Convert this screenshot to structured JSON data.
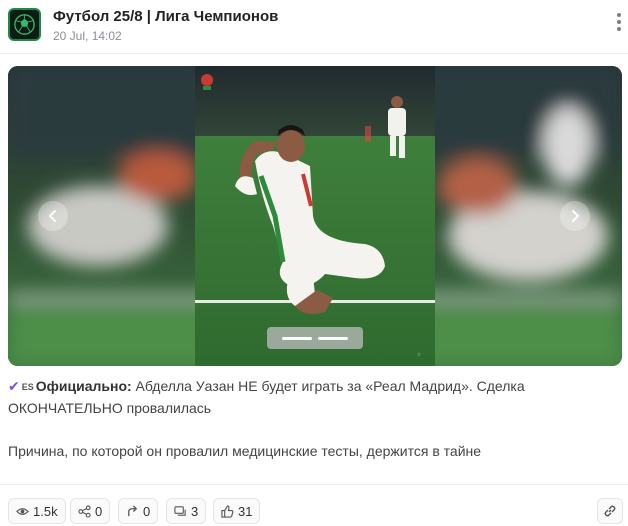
{
  "header": {
    "channel_title": "Футбол 25/8 | Лига Чемпионов",
    "post_time": "20 Jul, 14:02",
    "avatar_icon": "soccer-ball-logo",
    "more_icon": "vertical-dots-icon"
  },
  "gallery": {
    "prev_icon": "chevron-left-icon",
    "next_icon": "chevron-right-icon",
    "slide_count": 2,
    "active_slide": 1,
    "accent_color": "#1d8a4a"
  },
  "post": {
    "verified_icon": "✔",
    "flag_label": "ES",
    "lead_bold": "Официально:",
    "lead_text": " Абделла Уазан НЕ будет играть за «Реал Мадрид». Сделка ОКОНЧАТЕЛЬНО провалилась",
    "paragraph2": "Причина, по которой он провалил медицинские тесты, держится в тайне"
  },
  "footer": {
    "views": "1.5k",
    "forwards": "0",
    "shares": "0",
    "comments": "3",
    "likes": "31",
    "icons": [
      "eye-icon",
      "share-nodes-icon",
      "reply-arrow-icon",
      "comment-icon",
      "thumbs-up-icon",
      "link-icon"
    ]
  }
}
